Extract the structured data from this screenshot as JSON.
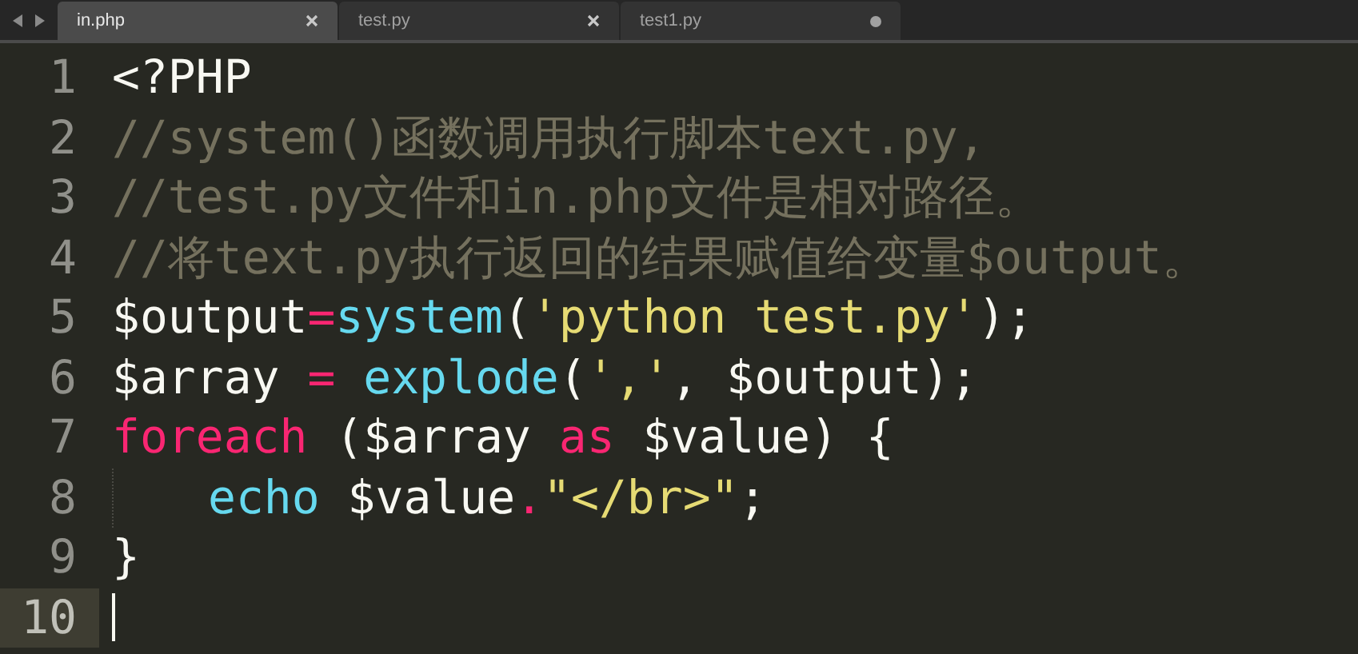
{
  "tabs": [
    {
      "label": "in.php",
      "selected": true,
      "modified": false
    },
    {
      "label": "test.py",
      "selected": false,
      "modified": false
    },
    {
      "label": "test1.py",
      "selected": false,
      "modified": true
    }
  ],
  "lines": [
    {
      "number": "1",
      "current": false,
      "indent": false,
      "tokens": [
        {
          "kind": "plain",
          "text": "<?PHP"
        }
      ]
    },
    {
      "number": "2",
      "current": false,
      "indent": false,
      "tokens": [
        {
          "kind": "comment",
          "text": "//system()函数调用执行脚本text.py,"
        }
      ]
    },
    {
      "number": "3",
      "current": false,
      "indent": false,
      "tokens": [
        {
          "kind": "comment",
          "text": "//test.py文件和in.php文件是相对路径。"
        }
      ]
    },
    {
      "number": "4",
      "current": false,
      "indent": false,
      "tokens": [
        {
          "kind": "comment",
          "text": "//将text.py执行返回的结果赋值给变量$output。"
        }
      ]
    },
    {
      "number": "5",
      "current": false,
      "indent": false,
      "tokens": [
        {
          "kind": "plain",
          "text": "$output"
        },
        {
          "kind": "operator",
          "text": "="
        },
        {
          "kind": "function",
          "text": "system"
        },
        {
          "kind": "plain",
          "text": "("
        },
        {
          "kind": "string",
          "text": "'python test.py'"
        },
        {
          "kind": "plain",
          "text": ");"
        }
      ]
    },
    {
      "number": "6",
      "current": false,
      "indent": false,
      "tokens": [
        {
          "kind": "plain",
          "text": "$array "
        },
        {
          "kind": "operator",
          "text": "= "
        },
        {
          "kind": "function",
          "text": "explode"
        },
        {
          "kind": "plain",
          "text": "("
        },
        {
          "kind": "string",
          "text": "','"
        },
        {
          "kind": "plain",
          "text": ", $output);"
        }
      ]
    },
    {
      "number": "7",
      "current": false,
      "indent": false,
      "tokens": [
        {
          "kind": "keyword",
          "text": "foreach"
        },
        {
          "kind": "plain",
          "text": " ($array "
        },
        {
          "kind": "keyword",
          "text": "as"
        },
        {
          "kind": "plain",
          "text": " $value) {"
        }
      ]
    },
    {
      "number": "8",
      "current": false,
      "indent": true,
      "tokens": [
        {
          "kind": "function",
          "text": "echo"
        },
        {
          "kind": "plain",
          "text": " $value"
        },
        {
          "kind": "operator",
          "text": "."
        },
        {
          "kind": "string",
          "text": "\"</br>\""
        },
        {
          "kind": "plain",
          "text": ";"
        }
      ]
    },
    {
      "number": "9",
      "current": false,
      "indent": false,
      "tokens": [
        {
          "kind": "plain",
          "text": "}"
        }
      ]
    },
    {
      "number": "10",
      "current": true,
      "indent": false
    }
  ]
}
